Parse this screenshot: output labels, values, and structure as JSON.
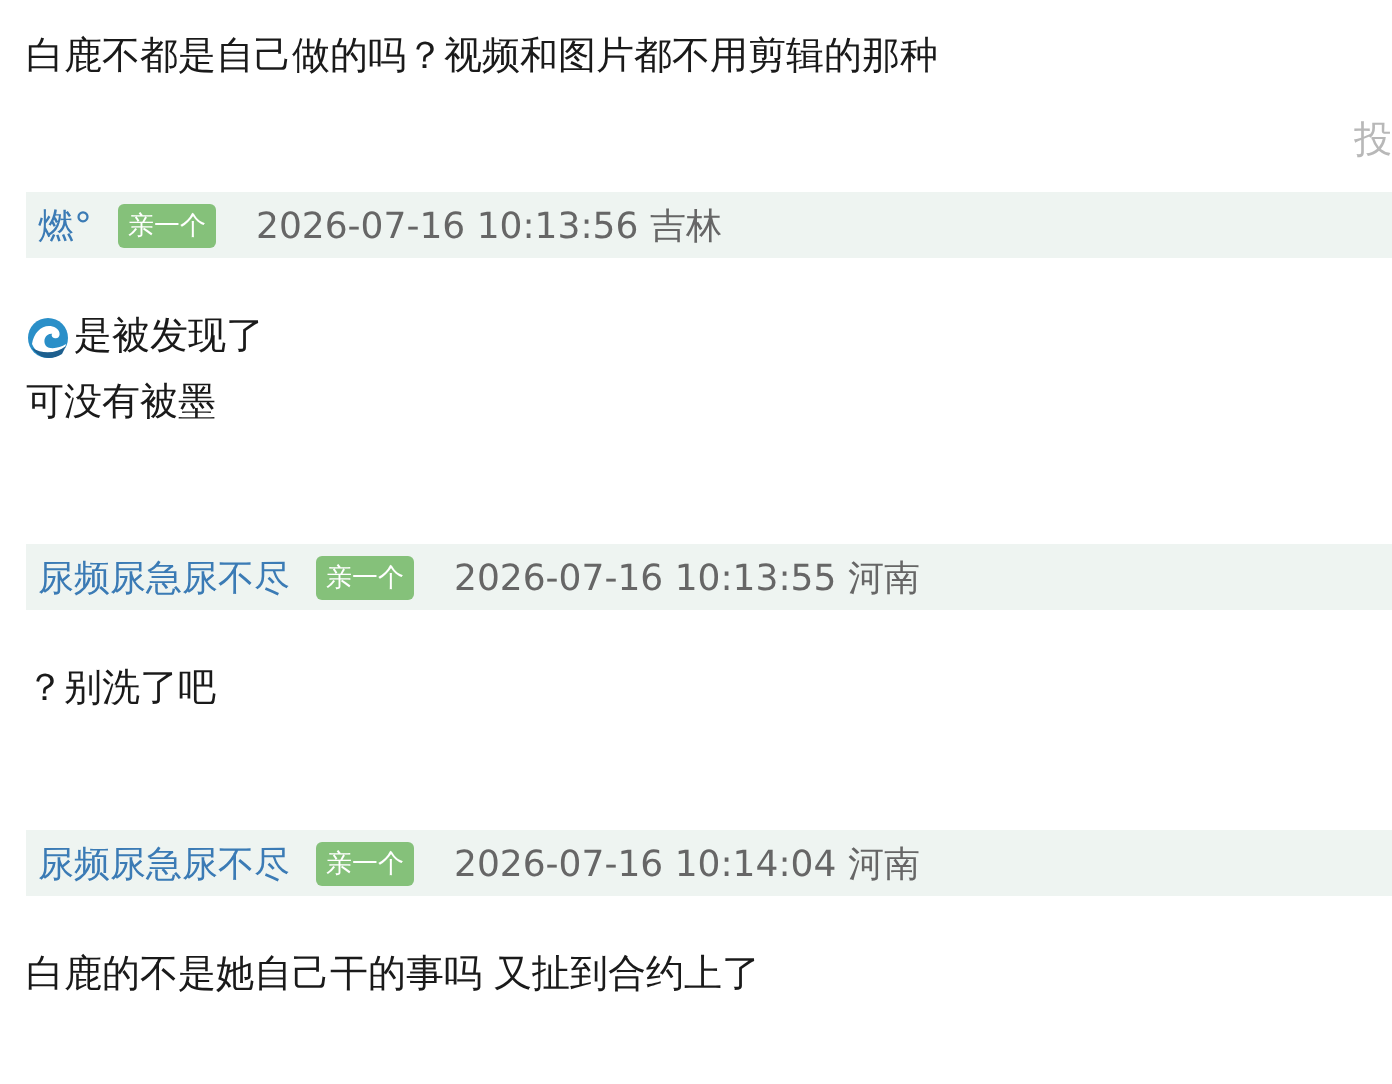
{
  "intro": {
    "text": "白鹿不都是自己做的吗？视频和图片都不用剪辑的那种",
    "report_link": "投"
  },
  "posts": [
    {
      "user": "燃°",
      "badge": "亲一个",
      "time": "2026-07-16 10:13:56",
      "location": "吉林",
      "lines": [
        {
          "kind": "wave",
          "text": "是被发现了"
        },
        {
          "kind": "plain",
          "text": "可没有被墨"
        }
      ]
    },
    {
      "user": "尿频尿急尿不尽",
      "badge": "亲一个",
      "time": "2026-07-16 10:13:55",
      "location": "河南",
      "lines": [
        {
          "kind": "plain",
          "text": "？别洗了吧"
        }
      ]
    },
    {
      "user": "尿频尿急尿不尽",
      "badge": "亲一个",
      "time": "2026-07-16 10:14:04",
      "location": "河南",
      "lines": [
        {
          "kind": "plain",
          "text": "白鹿的不是她自己干的事吗 又扯到合约上了"
        }
      ]
    }
  ]
}
